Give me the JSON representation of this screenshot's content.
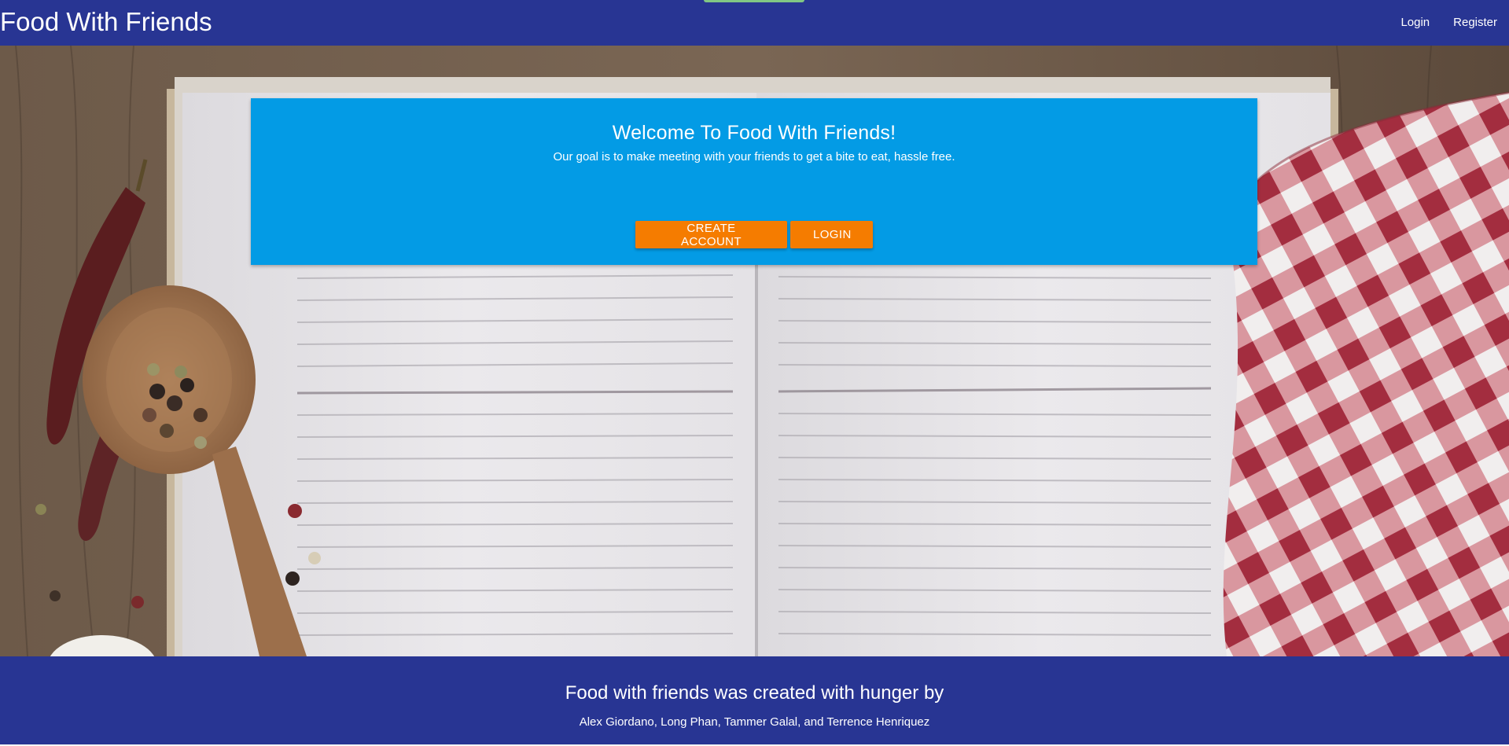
{
  "navbar": {
    "brand": "Food With Friends",
    "links": [
      "Login",
      "Register"
    ]
  },
  "hero": {
    "title": "Welcome To Food With Friends!",
    "subtitle": "Our goal is to make meeting with your friends to get a bite to eat, hassle free.",
    "create_account_label": "CREATE ACCOUNT",
    "login_label": "LOGIN"
  },
  "footer": {
    "heading": "Food with friends was created with hunger by",
    "credits": "Alex Giordano, Long Phan, Tammer Galal, and Terrence Henriquez"
  },
  "colors": {
    "navbar": "#283593",
    "card": "#039be5",
    "button": "#f57c00"
  }
}
